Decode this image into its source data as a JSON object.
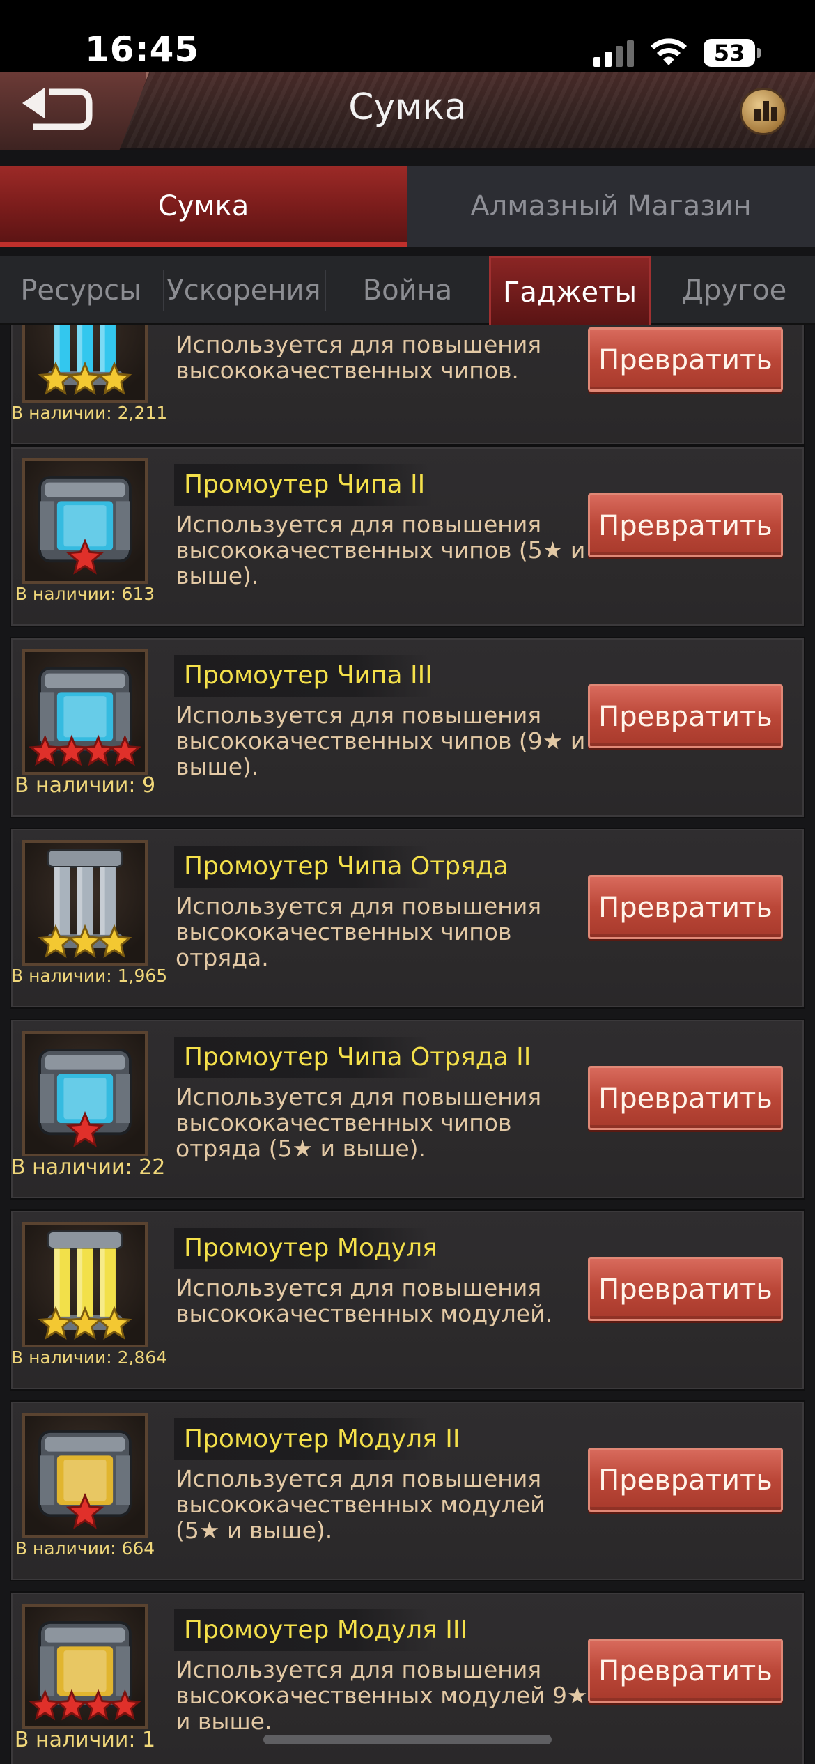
{
  "status_bar": {
    "time": "16:45",
    "battery": "53"
  },
  "header": {
    "title": "Сумка",
    "back_icon": "back-arrow-icon",
    "rank_icon": "leaderboard-icon"
  },
  "main_tabs": [
    {
      "label": "Сумка",
      "active": true
    },
    {
      "label": "Алмазный Магазин",
      "active": false
    }
  ],
  "sub_tabs": [
    {
      "label": "Ресурсы",
      "active": false
    },
    {
      "label": "Ускорения",
      "active": false
    },
    {
      "label": "Война",
      "active": false
    },
    {
      "label": "Гаджеты",
      "active": true
    },
    {
      "label": "Другое",
      "active": false
    }
  ],
  "items": [
    {
      "name": "",
      "desc": "Используется для повышения высококачественных чипов.",
      "stock": "В наличии: 2,211",
      "button": "Превратить",
      "icon": "chip-promoter-blue-icon",
      "stars": 3,
      "color": "#33c7ee"
    },
    {
      "name": "Промоутер Чипа II",
      "desc": "Используется для повышения высококачественных чипов (5★ и выше).",
      "stock": "В наличии: 613",
      "button": "Превратить",
      "icon": "chip-promoter-blue-box-icon",
      "stars": 1,
      "color": "#33c7ee"
    },
    {
      "name": "Промоутер Чипа III",
      "desc": "Используется для повышения высококачественных чипов (9★ и выше).",
      "stock": "В наличии: 9",
      "button": "Превратить",
      "icon": "chip-promoter-blue-crate-icon",
      "stars": 4,
      "color": "#33c7ee"
    },
    {
      "name": "Промоутер Чипа Отряда",
      "desc": "Используется для повышения высококачественных чипов отряда.",
      "stock": "В наличии: 1,965",
      "button": "Превратить",
      "icon": "squad-chip-promoter-icon",
      "stars": 3,
      "color": "#a9b3bd"
    },
    {
      "name": "Промоутер Чипа Отряда II",
      "desc": "Используется для повышения высококачественных чипов отряда (5★ и выше).",
      "stock": "В наличии: 22",
      "button": "Превратить",
      "icon": "squad-chip-promoter-box-icon",
      "stars": 1,
      "color": "#33c7ee"
    },
    {
      "name": "Промоутер Модуля",
      "desc": "Используется для повышения высококачественных модулей.",
      "stock": "В наличии: 2,864",
      "button": "Превратить",
      "icon": "module-promoter-yellow-icon",
      "stars": 3,
      "color": "#f2e04a"
    },
    {
      "name": "Промоутер Модуля II",
      "desc": "Используется для повышения высококачественных модулей (5★ и выше).",
      "stock": "В наличии: 664",
      "button": "Превратить",
      "icon": "module-promoter-yellow-box-icon",
      "stars": 1,
      "color": "#f2c02a"
    },
    {
      "name": "Промоутер Модуля III",
      "desc": "Используется для повышения высококачественных модулей 9★ и выше.",
      "stock": "В наличии: 1",
      "button": "Превратить",
      "icon": "module-promoter-yellow-crate-icon",
      "stars": 4,
      "color": "#f2c02a"
    }
  ]
}
